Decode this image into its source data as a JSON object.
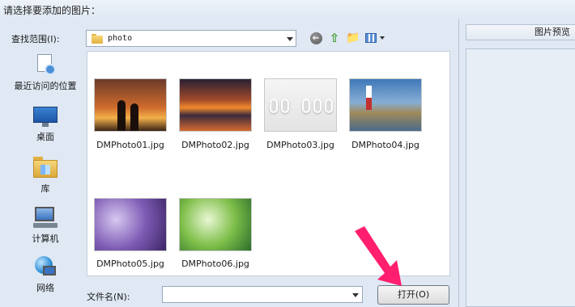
{
  "dialog": {
    "title": "请选择要添加的图片："
  },
  "look_in": {
    "label": "查找范围(I):",
    "value": "photo"
  },
  "places": [
    {
      "label": "最近访问的位置"
    },
    {
      "label": "桌面"
    },
    {
      "label": "库"
    },
    {
      "label": "计算机"
    },
    {
      "label": "网络"
    }
  ],
  "files": [
    {
      "name": "DMPhoto01.jpg"
    },
    {
      "name": "DMPhoto02.jpg"
    },
    {
      "name": "DMPhoto03.jpg"
    },
    {
      "name": "DMPhoto04.jpg"
    },
    {
      "name": "DMPhoto05.jpg"
    },
    {
      "name": "DMPhoto06.jpg"
    }
  ],
  "file_name": {
    "label": "文件名(N):",
    "value": ""
  },
  "open_button": {
    "label": "打开(O)"
  },
  "preview": {
    "title": "图片预览"
  },
  "colors": {
    "annotation_arrow": "#ff1f6e",
    "dialog_bg": "#dfe8f3"
  }
}
